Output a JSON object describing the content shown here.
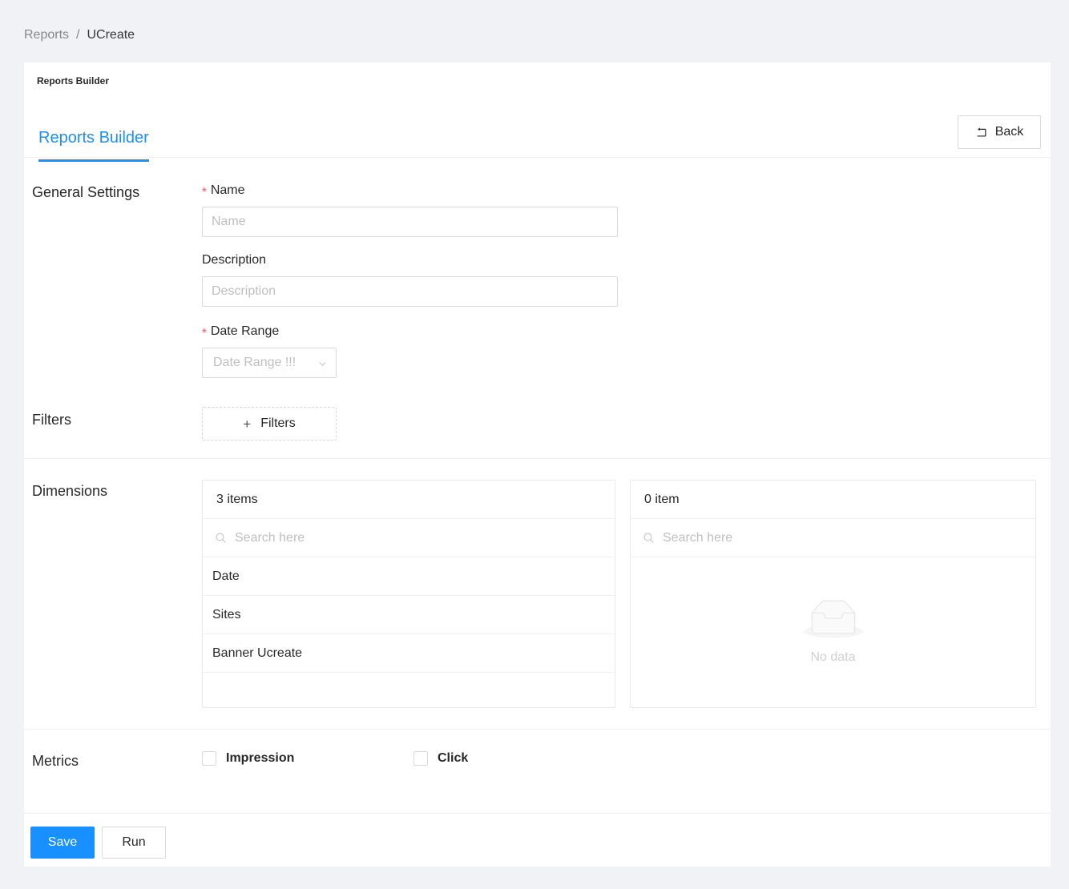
{
  "breadcrumb": {
    "parent": "Reports",
    "separator": "/",
    "current": "UCreate"
  },
  "card": {
    "head_title": "Reports Builder"
  },
  "tabs": [
    {
      "label": "Reports Builder",
      "active": true
    }
  ],
  "header_actions": {
    "back_label": "Back",
    "back_icon": "rollback-icon"
  },
  "general_settings": {
    "section_label": "General Settings",
    "name": {
      "label": "Name",
      "required_marker": "*",
      "value": "",
      "placeholder": "Name"
    },
    "description": {
      "label": "Description",
      "value": "",
      "placeholder": "Description"
    },
    "date_range": {
      "label": "Date Range",
      "required_marker": "*",
      "placeholder": "Date Range !!!",
      "icon": "chevron-down-icon"
    }
  },
  "filters": {
    "section_label": "Filters",
    "add_button_label": "Filters",
    "add_button_icon": "plus-icon"
  },
  "dimensions": {
    "section_label": "Dimensions",
    "source_panel": {
      "count_label": "3 items",
      "search_placeholder": "Search here",
      "search_icon": "search-icon",
      "items": [
        "Date",
        "Sites",
        "Banner Ucreate"
      ]
    },
    "target_panel": {
      "count_label": "0 item",
      "search_placeholder": "Search here",
      "search_icon": "search-icon",
      "items": [],
      "empty_text": "No data",
      "empty_icon": "empty-inbox-icon"
    }
  },
  "metrics": {
    "section_label": "Metrics",
    "options": [
      {
        "label": "Impression",
        "checked": false
      },
      {
        "label": "Click",
        "checked": false
      }
    ]
  },
  "footer": {
    "save_label": "Save",
    "run_label": "Run"
  },
  "colors": {
    "primary": "#1890ff",
    "page_background": "#f0f2f5",
    "required_star": "#ff4d4f",
    "placeholder": "#bfbfbf",
    "border": "#d9d9d9"
  }
}
